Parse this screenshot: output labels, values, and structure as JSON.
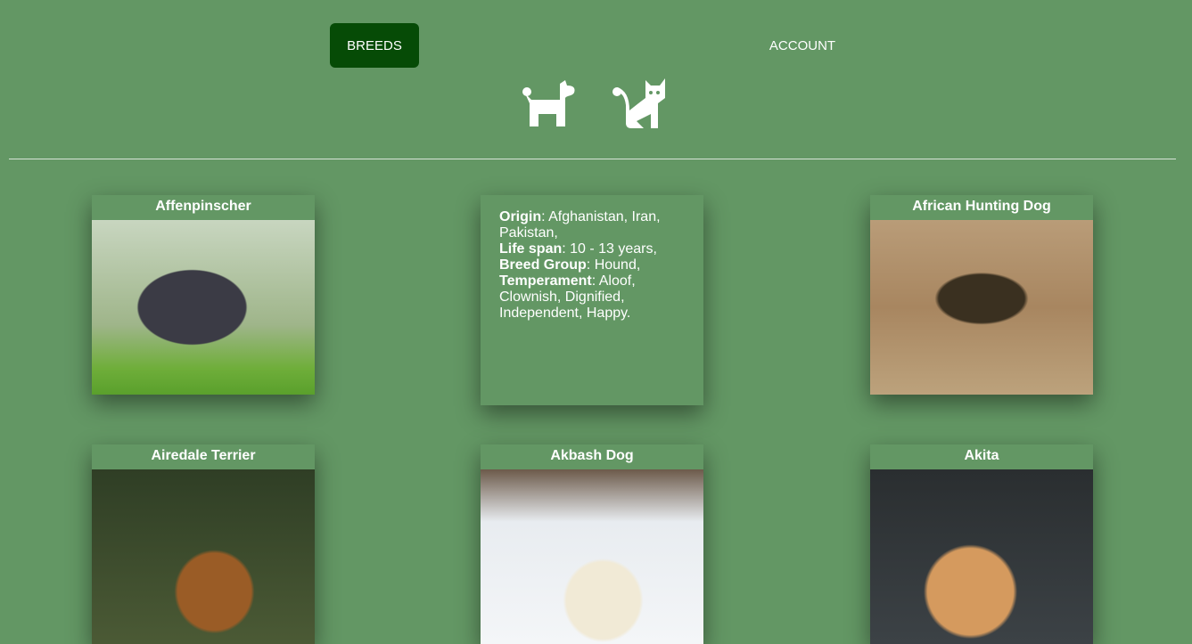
{
  "nav": {
    "breeds": "BREEDS",
    "account": "ACCOUNT"
  },
  "pet_icons": [
    "dog-icon",
    "cat-icon"
  ],
  "cards": [
    {
      "name": "Affenpinscher"
    },
    {
      "info": {
        "origin_label": "Origin",
        "origin": ": Afghanistan, Iran, Pakistan,",
        "life_label": "Life span",
        "life": ": 10 - 13 years,",
        "group_label": "Breed Group",
        "group": ": Hound,",
        "temp_label": "Temperament",
        "temp": ": Aloof, Clownish, Dignified, Independent, Happy."
      }
    },
    {
      "name": "African Hunting Dog"
    },
    {
      "name": "Airedale Terrier"
    },
    {
      "name": "Akbash Dog"
    },
    {
      "name": "Akita"
    }
  ],
  "colors": {
    "bg": "#639764",
    "active": "#064b06"
  }
}
